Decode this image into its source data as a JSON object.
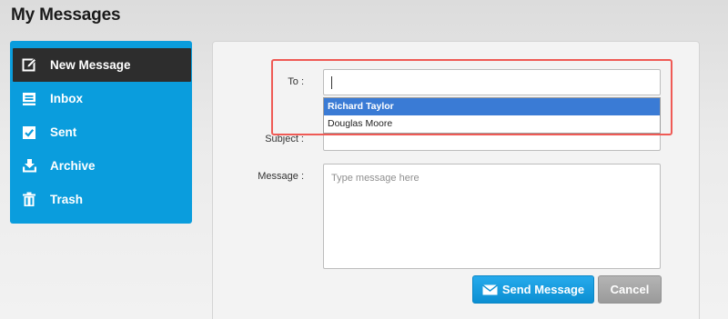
{
  "page": {
    "title": "My Messages"
  },
  "sidebar": {
    "items": [
      {
        "label": "New Message",
        "icon": "compose-icon",
        "active": true
      },
      {
        "label": "Inbox",
        "icon": "inbox-icon"
      },
      {
        "label": "Sent",
        "icon": "sent-check-icon"
      },
      {
        "label": "Archive",
        "icon": "archive-download-icon"
      },
      {
        "label": "Trash",
        "icon": "trash-icon"
      }
    ]
  },
  "form": {
    "to_label": "To :",
    "to_value": "",
    "subject_label": "Subject :",
    "message_label": "Message :",
    "message_placeholder": "Type message here",
    "suggestions": [
      {
        "name": "Richard Taylor",
        "selected": true
      },
      {
        "name": "Douglas Moore",
        "selected": false
      }
    ],
    "send_label": "Send Message",
    "cancel_label": "Cancel"
  },
  "colors": {
    "sidebar_bg": "#0a9ddd",
    "active_item_bg": "#2d2d2d",
    "selected_suggestion": "#3a7bd5",
    "highlight_border": "#ef5a55",
    "send_button": "#0b8fd2",
    "cancel_button": "#9a9a9a"
  }
}
